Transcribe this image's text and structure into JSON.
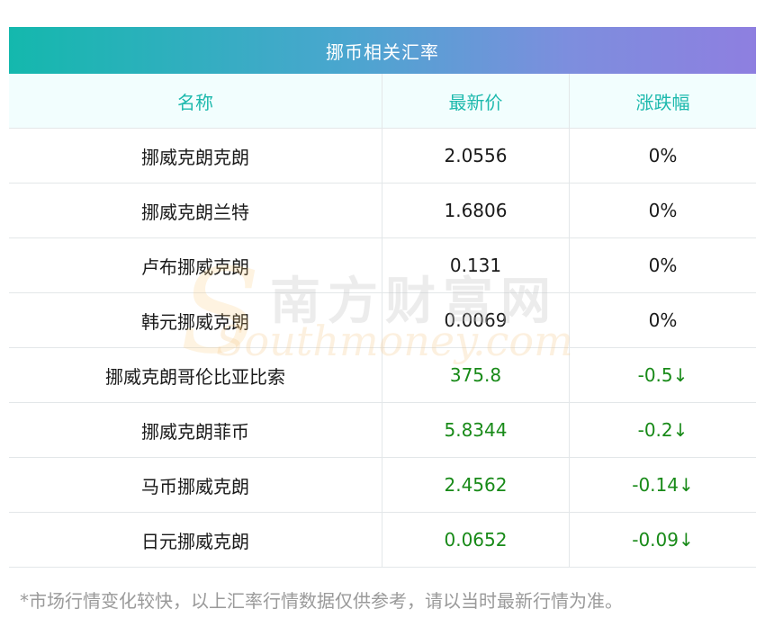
{
  "table": {
    "title": "挪币相关汇率",
    "columns": [
      "名称",
      "最新价",
      "涨跌幅"
    ],
    "rows": [
      {
        "name": "挪威克朗克朗",
        "price": "2.0556",
        "change": "0%",
        "trend": "flat"
      },
      {
        "name": "挪威克朗兰特",
        "price": "1.6806",
        "change": "0%",
        "trend": "flat"
      },
      {
        "name": "卢布挪威克朗",
        "price": "0.131",
        "change": "0%",
        "trend": "flat"
      },
      {
        "name": "韩元挪威克朗",
        "price": "0.0069",
        "change": "0%",
        "trend": "flat"
      },
      {
        "name": "挪威克朗哥伦比亚比索",
        "price": "375.8",
        "change": "-0.5↓",
        "trend": "down"
      },
      {
        "name": "挪威克朗菲币",
        "price": "5.8344",
        "change": "-0.2↓",
        "trend": "down"
      },
      {
        "name": "马币挪威克朗",
        "price": "2.4562",
        "change": "-0.14↓",
        "trend": "down"
      },
      {
        "name": "日元挪威克朗",
        "price": "0.0652",
        "change": "-0.09↓",
        "trend": "down"
      }
    ]
  },
  "watermark": {
    "cn": "南方财富网",
    "en": "Southmoney.com"
  },
  "footnote": "*市场行情变化较快，以上汇率行情数据仅供参考，请以当时最新行情为准。",
  "colors": {
    "header_text": "#1db9ad",
    "down": "#188a18",
    "title_gradient_start": "#14b8ad",
    "title_gradient_end": "#8e7fe0"
  }
}
